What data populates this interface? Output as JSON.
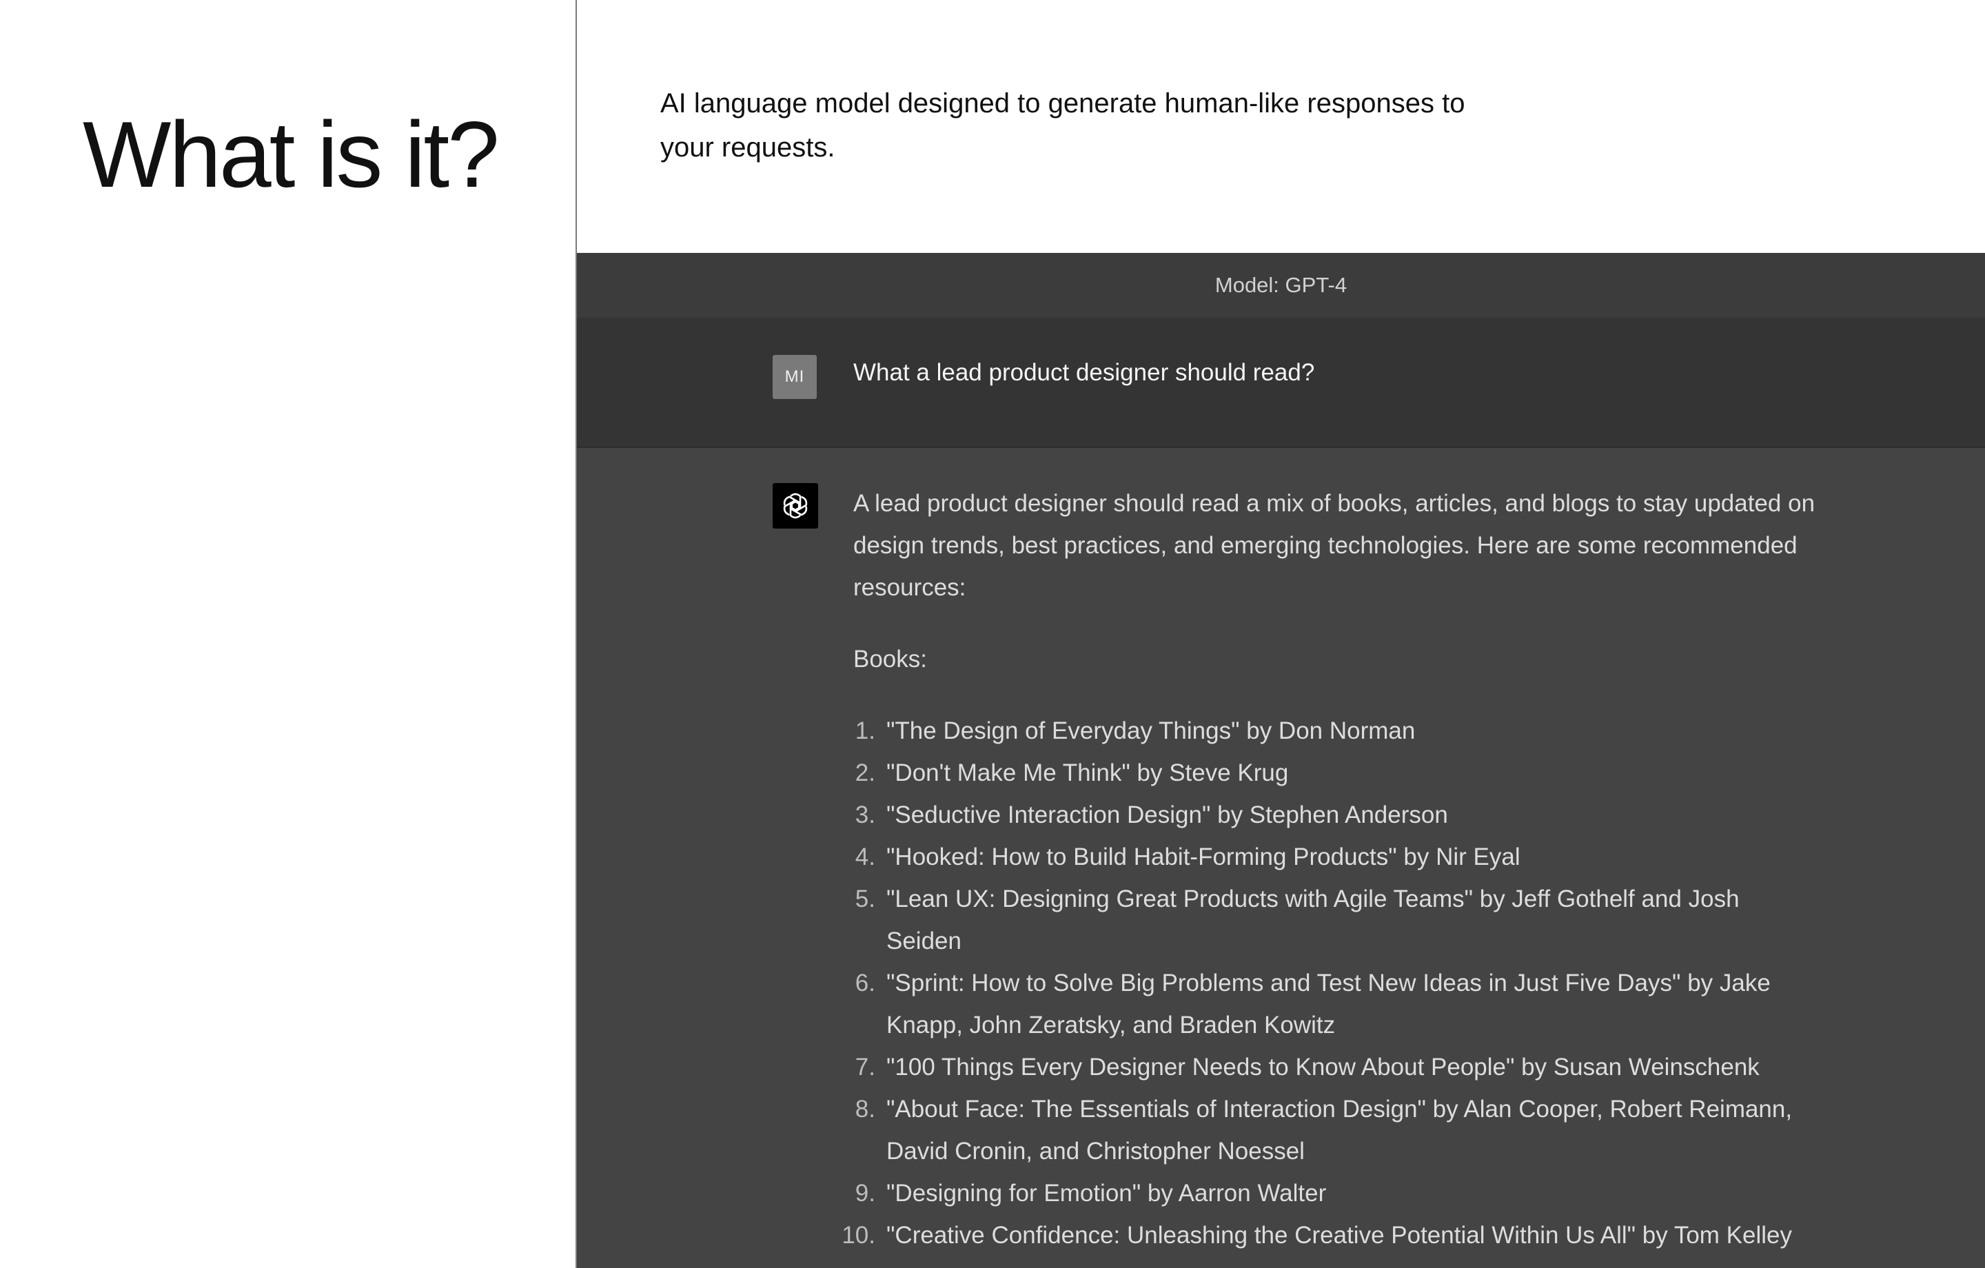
{
  "slide": {
    "title": "What is it?",
    "description": "AI language model designed to generate human-like responses to your requests."
  },
  "chat": {
    "model_label": "Model: GPT-4",
    "user": {
      "avatar_initials": "MI",
      "message": "What a lead product designer should read?"
    },
    "assistant": {
      "intro": "A lead product designer should read a mix of books, articles, and blogs to stay updated on design trends, best practices, and emerging technologies. Here are some recommended resources:",
      "books_heading": "Books:",
      "books": [
        {
          "num": "1.",
          "text": "\"The Design of Everyday Things\" by Don Norman"
        },
        {
          "num": "2.",
          "text": "\"Don't Make Me Think\" by Steve Krug"
        },
        {
          "num": "3.",
          "text": "\"Seductive Interaction Design\" by Stephen Anderson"
        },
        {
          "num": "4.",
          "text": "\"Hooked: How to Build Habit-Forming Products\" by Nir Eyal"
        },
        {
          "num": "5.",
          "text": "\"Lean UX: Designing Great Products with Agile Teams\" by Jeff Gothelf and Josh Seiden"
        },
        {
          "num": "6.",
          "text": "\"Sprint: How to Solve Big Problems and Test New Ideas in Just Five Days\" by Jake Knapp, John Zeratsky, and Braden Kowitz"
        },
        {
          "num": "7.",
          "text": "\"100 Things Every Designer Needs to Know About People\" by Susan Weinschenk"
        },
        {
          "num": "8.",
          "text": "\"About Face: The Essentials of Interaction Design\" by Alan Cooper, Robert Reimann, David Cronin, and Christopher Noessel"
        },
        {
          "num": "9.",
          "text": "\"Designing for Emotion\" by Aarron Walter"
        },
        {
          "num": "10.",
          "text": "\"Creative Confidence: Unleashing the Creative Potential Within Us All\" by Tom Kelley"
        }
      ]
    }
  },
  "icons": {
    "assistant_avatar": "openai-logo-icon"
  },
  "colors": {
    "chat_background": "#444444",
    "model_bar": "#3c3c3c",
    "user_row": "#343434",
    "user_avatar": "#7a7a7a",
    "assistant_avatar": "#000000"
  }
}
